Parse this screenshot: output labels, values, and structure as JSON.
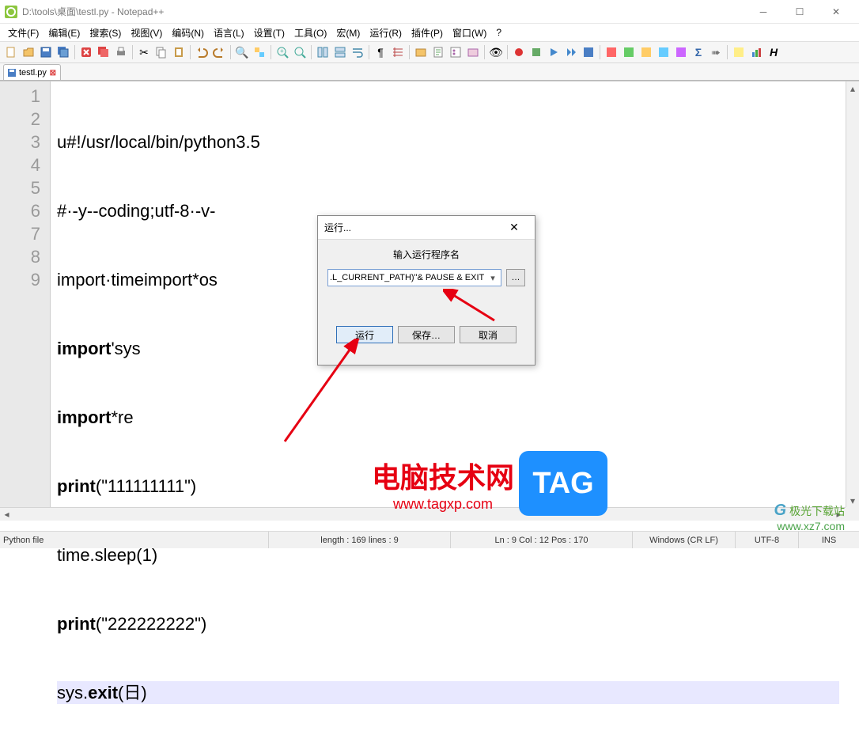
{
  "title": "D:\\tools\\桌面\\testl.py - Notepad++",
  "menus": [
    "文件(F)",
    "编辑(E)",
    "搜索(S)",
    "视图(V)",
    "编码(N)",
    "语言(L)",
    "设置(T)",
    "工具(O)",
    "宏(M)",
    "运行(R)",
    "插件(P)",
    "窗口(W)",
    "?"
  ],
  "tab": {
    "label": "testl.py"
  },
  "line_numbers": [
    "1",
    "2",
    "3",
    "4",
    "5",
    "6",
    "7",
    "8",
    "9"
  ],
  "code": {
    "l1": "u#!/usr/local/bin/python3.5",
    "l2": "#·-y--coding;utf-8·-v-",
    "l3": "import·timeimport*os",
    "l4a": "import",
    "l4b": "'sys",
    "l5a": "import",
    "l5b": "*re",
    "l6a": "print",
    "l6b": "(\"111111111\")",
    "l7": "time.sleep(1)",
    "l8a": "print",
    "l8b": "(\"222222222\")",
    "l9a": "sys.",
    "l9b": "exit",
    "l9c": "(日)"
  },
  "run_dialog": {
    "title": "运行...",
    "label": "输入运行程序名",
    "value": ".L_CURRENT_PATH)\"& PAUSE & EXIT",
    "browse": "…",
    "run": "运行",
    "save": "保存…",
    "cancel": "取消"
  },
  "status": {
    "filetype": "Python file",
    "length": "length : 169    lines : 9",
    "pos": "Ln : 9    Col : 12    Pos : 170",
    "eol": "Windows (CR LF)",
    "enc": "UTF-8",
    "ins": "INS"
  },
  "watermark": {
    "site1_name": "电脑技术网",
    "site1_url": "www.tagxp.com",
    "tag": "TAG",
    "site2_name": "极光下载站",
    "site2_url": "www.xz7.com"
  }
}
